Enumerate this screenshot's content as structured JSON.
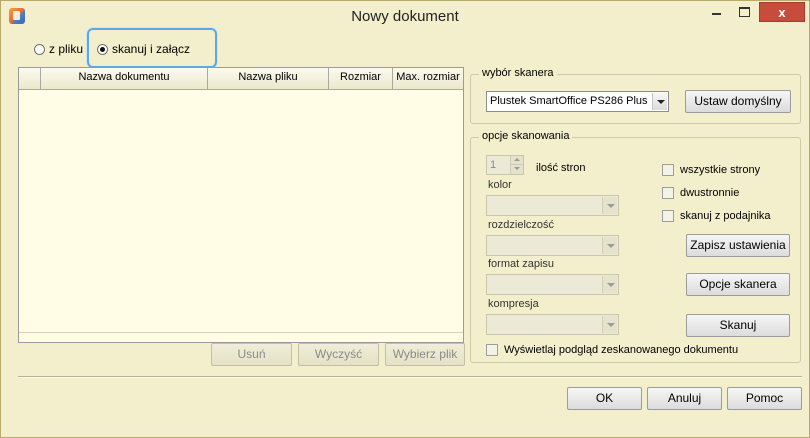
{
  "window": {
    "title": "Nowy dokument",
    "close_symbol": "x"
  },
  "source": {
    "option_file": "z pliku",
    "option_scan": "skanuj i załącz",
    "selected": "skanuj i załącz"
  },
  "table": {
    "columns": [
      "",
      "Nazwa dokumentu",
      "Nazwa pliku",
      "Rozmiar",
      "Max. rozmiar"
    ],
    "rows": []
  },
  "table_buttons": {
    "remove": "Usuń",
    "clear": "Wyczyść",
    "choose_file": "Wybierz plik"
  },
  "scanner_group": {
    "legend": "wybór skanera",
    "selected_scanner": "Plustek SmartOffice PS286 Plus",
    "set_default_button": "Ustaw domyślny"
  },
  "scan_options": {
    "legend": "opcje skanowania",
    "page_count_value": "1",
    "page_count_label": "ilość stron",
    "color_label": "kolor",
    "resolution_label": "rozdzielczość",
    "format_label": "format zapisu",
    "compression_label": "kompresja",
    "all_pages": "wszystkie strony",
    "duplex": "dwustronnie",
    "feeder": "skanuj z podajnika",
    "save_settings_button": "Zapisz ustawienia",
    "scanner_options_button": "Opcje skanera",
    "scan_button": "Skanuj",
    "preview_checkbox": "Wyświetlaj podgląd zeskanowanego dokumentu"
  },
  "footer": {
    "ok": "OK",
    "cancel": "Anuluj",
    "help": "Pomoc"
  },
  "colors": {
    "window_background": "#f3efcd",
    "grid_background": "#fffde5",
    "close_button": "#c74c3c",
    "focus_ring": "#5fa7e4"
  }
}
